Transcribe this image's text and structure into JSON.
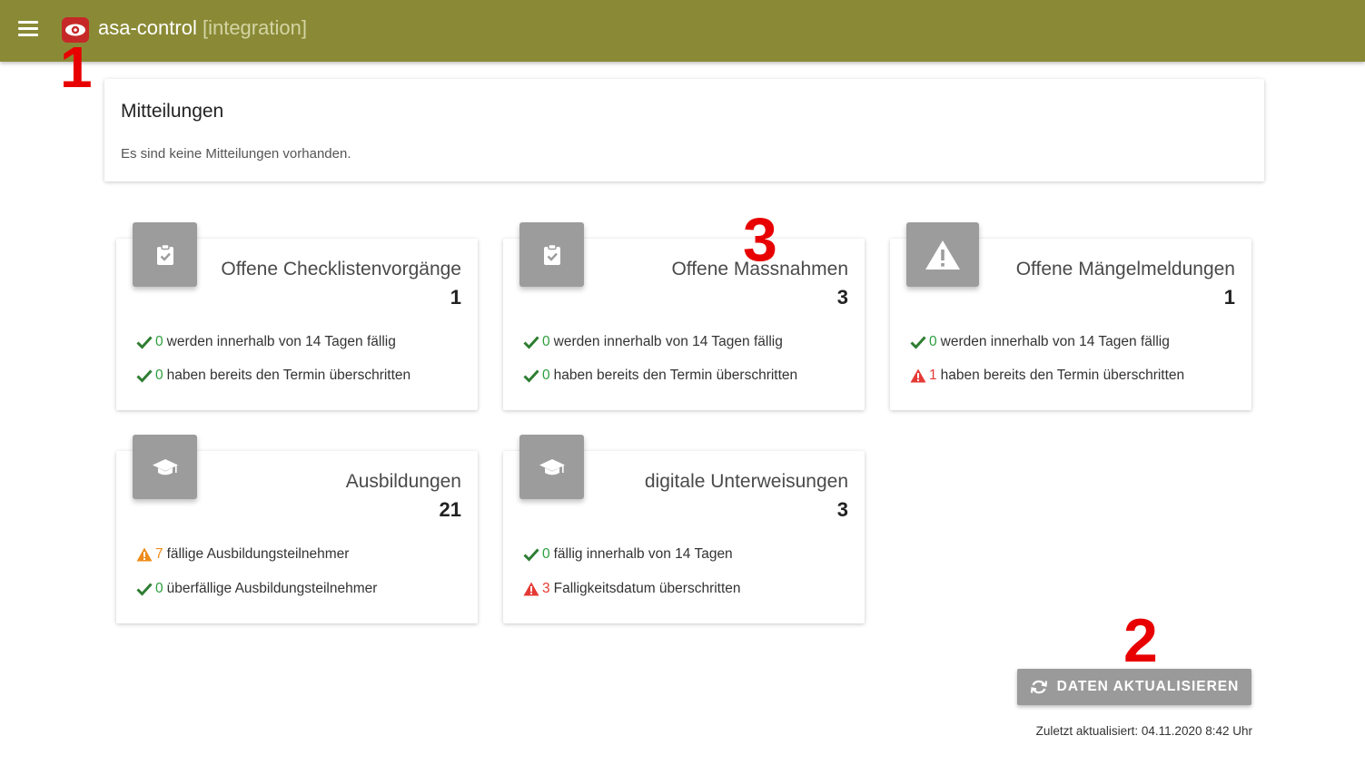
{
  "header": {
    "app_name": "asa-control",
    "environment": "[integration]",
    "menu_icon": "hamburger-menu-icon",
    "logo_icon": "eye-logo-icon",
    "bar_color": "#8a8a36"
  },
  "annotations": {
    "one": "1",
    "two": "2",
    "three": "3"
  },
  "messages": {
    "title": "Mitteilungen",
    "text": "Es sind keine Mitteilungen vorhanden."
  },
  "cards": [
    {
      "title": "Offene Checklistenvorgänge",
      "count": "1",
      "icon": "clipboard-check-icon",
      "rows": [
        {
          "status": "ok",
          "num": "0",
          "text": "werden innerhalb von 14 Tagen fällig"
        },
        {
          "status": "ok",
          "num": "0",
          "text": "haben bereits den Termin überschritten"
        }
      ]
    },
    {
      "title": "Offene Massnahmen",
      "count": "3",
      "icon": "clipboard-check-icon",
      "rows": [
        {
          "status": "ok",
          "num": "0",
          "text": "werden innerhalb von 14 Tagen fällig"
        },
        {
          "status": "ok",
          "num": "0",
          "text": "haben bereits den Termin überschritten"
        }
      ]
    },
    {
      "title": "Offene Mängelmeldungen",
      "count": "1",
      "icon": "warning-triangle-icon",
      "rows": [
        {
          "status": "ok",
          "num": "0",
          "text": "werden innerhalb von 14 Tagen fällig"
        },
        {
          "status": "error",
          "num": "1",
          "text": "haben bereits den Termin überschritten"
        }
      ]
    },
    {
      "title": "Ausbildungen",
      "count": "21",
      "icon": "graduation-cap-icon",
      "rows": [
        {
          "status": "warning",
          "num": "7",
          "text": "fällige Ausbildungsteilnehmer"
        },
        {
          "status": "ok",
          "num": "0",
          "text": "überfällige Ausbildungsteilnehmer"
        }
      ]
    },
    {
      "title": "digitale Unterweisungen",
      "count": "3",
      "icon": "graduation-cap-icon",
      "rows": [
        {
          "status": "ok",
          "num": "0",
          "text": "fällig innerhalb von 14 Tagen"
        },
        {
          "status": "error",
          "num": "3",
          "text": "Falligkeitsdatum überschritten"
        }
      ]
    }
  ],
  "refresh": {
    "label": "DATEN AKTUALISIEREN",
    "icon": "refresh-icon",
    "last_updated": "Zuletzt aktualisiert: 04.11.2020 8:42 Uhr"
  },
  "colors": {
    "ok": "#2e9e3e",
    "error": "#e53935",
    "warning": "#ef8c1a",
    "icon_bg": "#9c9c9c"
  }
}
